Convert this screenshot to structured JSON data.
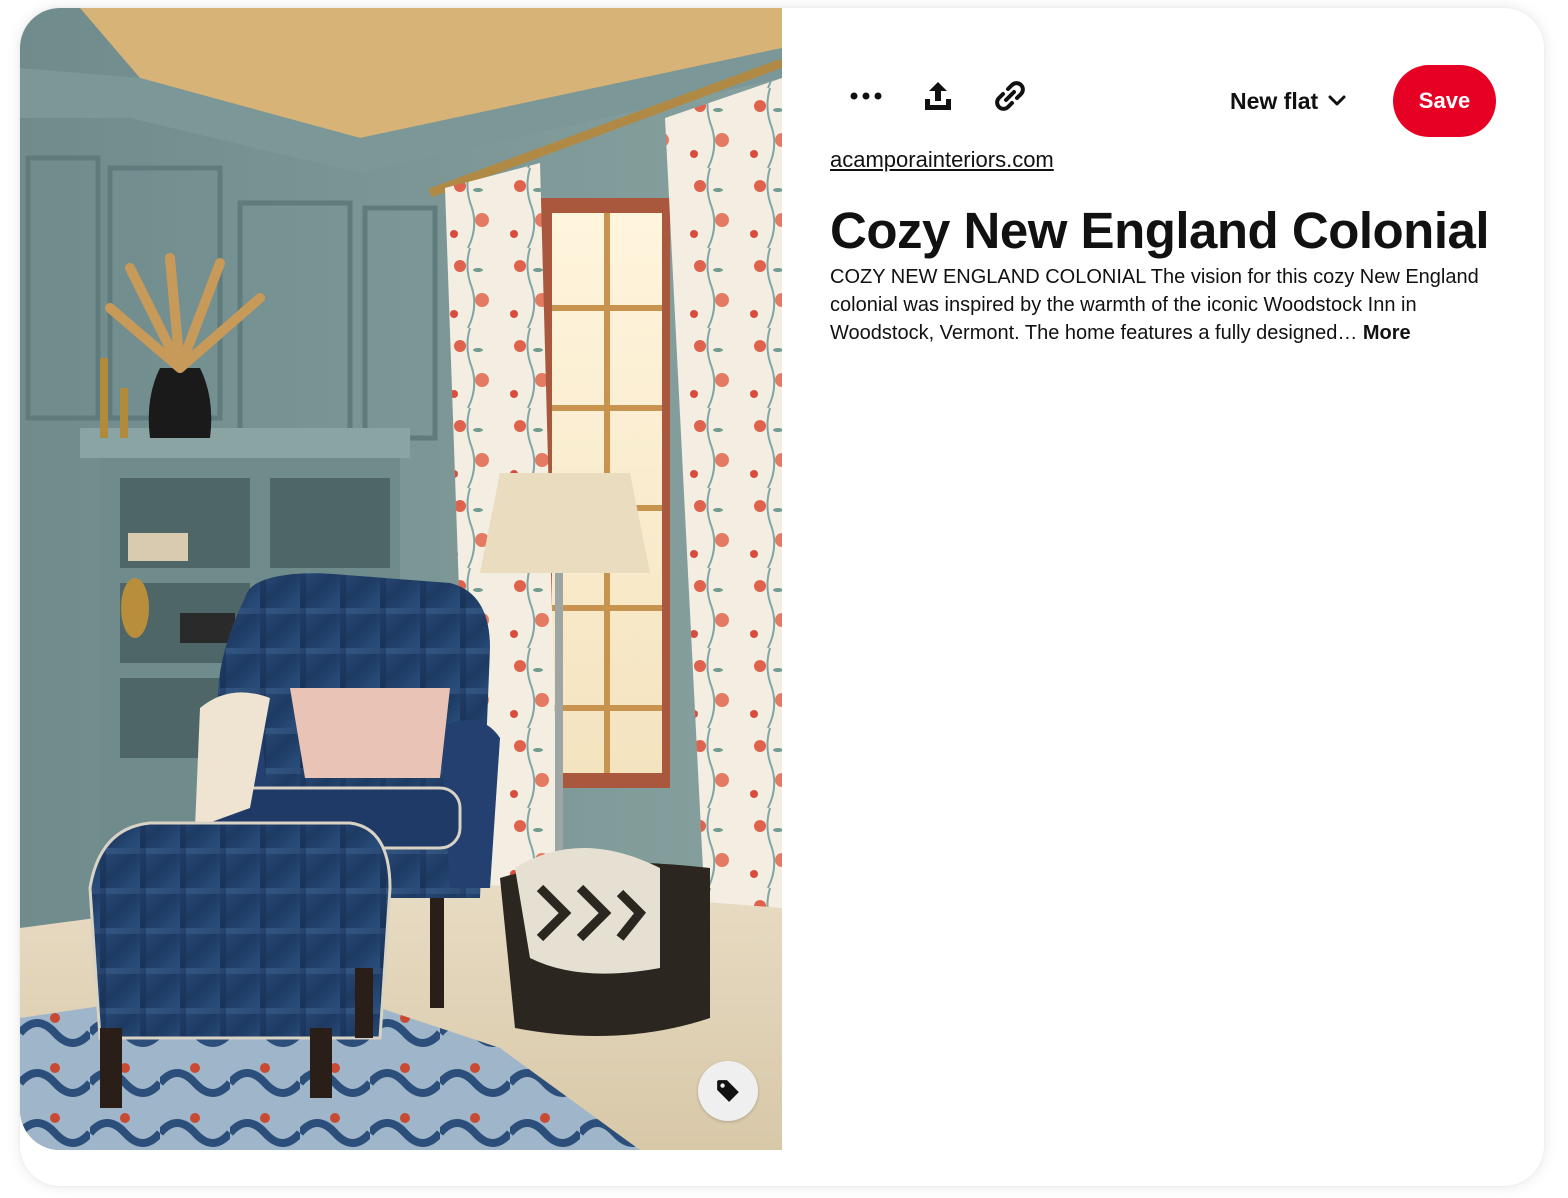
{
  "toolbar": {
    "more_icon": "ellipsis-icon",
    "share_icon": "share-icon",
    "link_icon": "link-icon"
  },
  "board_select": {
    "selected": "New flat",
    "icon": "chevron-down-icon"
  },
  "save_label": "Save",
  "pin": {
    "source": "acamporainteriors.com",
    "title": "Cozy New England Colonial",
    "description": "COZY NEW ENGLAND COLONIAL The vision for this cozy New England colonial was inspired by the warmth of the iconic Woodstock Inn in Woodstock, Vermont. The home features a fully designed…",
    "more_label": "More",
    "tag_icon": "tag-icon"
  },
  "colors": {
    "save": "#e60023",
    "text": "#111111",
    "tag_button_bg": "#efefef"
  }
}
